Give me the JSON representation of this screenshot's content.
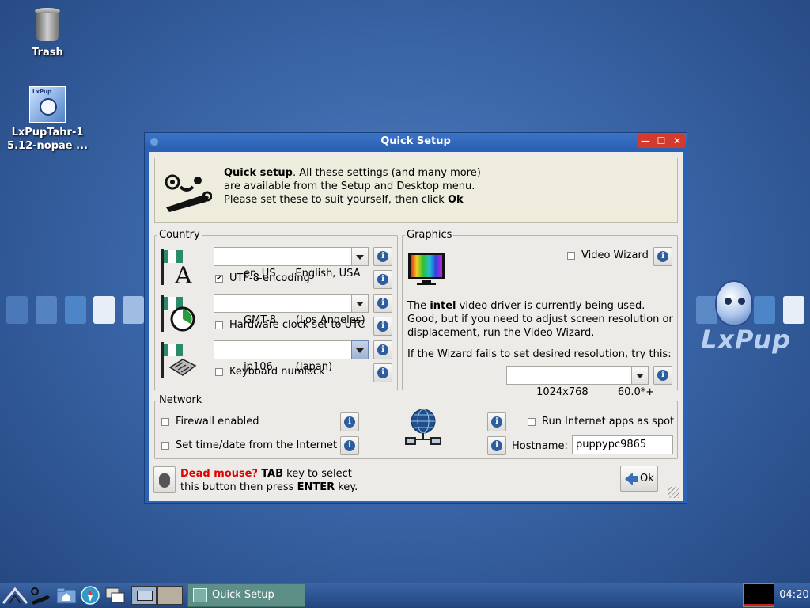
{
  "desktop": {
    "icons": [
      {
        "label_1": "Trash",
        "label_2": ""
      },
      {
        "label_1": "LxPupTahr-1",
        "label_2": "5.12-nopae ..."
      }
    ],
    "brand_text": "LxPup"
  },
  "window": {
    "title": "Quick Setup",
    "controls": {
      "minimize": "—",
      "maximize": "☐",
      "close": "✕"
    },
    "intro": {
      "bold": "Quick setup",
      "line1_rest": ". All these settings (and many more)",
      "line2": "are available from the Setup and Desktop menu.",
      "line3_pre": "Please set these to suit yourself, then click ",
      "line3_bold": "Ok"
    },
    "country": {
      "group_title": "Country",
      "locale_value": "en_US      English, USA",
      "utf8_label": "UTF-8 encoding",
      "utf8_checked": true,
      "timezone_value": "GMT-8      (Los Angeles)",
      "hwclock_label": "Hardware clock set to UTC",
      "hwclock_checked": false,
      "keyboard_value": "jp106       (Japan)",
      "numlock_label": "Keyboard numlock",
      "numlock_checked": false
    },
    "graphics": {
      "group_title": "Graphics",
      "video_wizard_label": "Video Wizard",
      "video_wizard_checked": false,
      "driver_pre": "The ",
      "driver_bold": "intel",
      "driver_post": " video driver is currently being used.",
      "line2": "Good, but if you need to adjust screen resolution or",
      "line3": "displacement, run the Video Wizard.",
      "fallback": "If the Wizard fails to set desired resolution, try this:",
      "resolution_value": "1024x768         60.0*+"
    },
    "network": {
      "group_title": "Network",
      "firewall_label": "Firewall enabled",
      "firewall_checked": false,
      "timedate_label": "Set time/date from the Internet",
      "timedate_checked": false,
      "spot_label": "Run Internet apps as spot",
      "spot_checked": false,
      "hostname_label": "Hostname:",
      "hostname_value": "puppypc9865"
    },
    "footer": {
      "dead_mouse": "Dead mouse?",
      "tab_bold": "TAB",
      "line1_rest": " key to select",
      "line2_pre": "this button then press ",
      "enter_bold": "ENTER",
      "line2_post": " key.",
      "ok_label": "Ok"
    },
    "info_glyph": "i"
  },
  "taskbar": {
    "task_label": "Quick Setup",
    "clock": "04:20"
  },
  "colors": {
    "desktop_bg": "#3a66a8",
    "titlebar": "#2a62b6",
    "close_red": "#d33a2e",
    "dead_mouse_red": "#e00000",
    "info_blue": "#2c5d9f"
  }
}
